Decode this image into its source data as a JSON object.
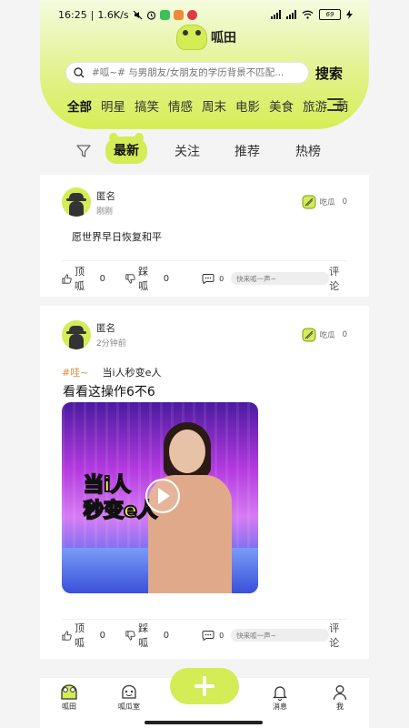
{
  "status_bar": {
    "time": "16:25",
    "speed": "1.6K/s",
    "battery": "69"
  },
  "app": {
    "logo_text": "呱田"
  },
  "search": {
    "placeholder": "#呱~# 与男朋友/女朋友的学历背景不匹配...",
    "button": "搜索"
  },
  "categories": [
    "全部",
    "明星",
    "搞笑",
    "情感",
    "周末",
    "电影",
    "美食",
    "旅游",
    "萌"
  ],
  "tabs": {
    "latest": "最新",
    "follow": "关注",
    "recommend": "推荐",
    "hot": "热榜"
  },
  "posts": [
    {
      "user": "匿名",
      "time": "刚刚",
      "eat_melon_label": "吃瓜",
      "eat_melon_count": "0",
      "text": "愿世界早日恢复和平",
      "likes_label": "顶呱",
      "likes": "0",
      "dislikes_label": "踩呱",
      "dislikes": "0",
      "comment_count": "0",
      "comment_placeholder": "快来呱一声~",
      "comment_label": "评论"
    },
    {
      "user": "匿名",
      "time": "2分钟前",
      "eat_melon_label": "吃瓜",
      "eat_melon_count": "0",
      "tag": "#哇~",
      "title": "当i人秒变e人",
      "body": "看看这操作6不6",
      "video_overlay_line1": "当i人",
      "video_overlay_line2": "秒变e人",
      "likes_label": "顶呱",
      "likes": "0",
      "dislikes_label": "踩呱",
      "dislikes": "0",
      "comment_count": "0",
      "comment_placeholder": "快来呱一声~",
      "comment_label": "评论"
    }
  ],
  "bottom_nav": {
    "home": "呱田",
    "melon_room": "呱瓜室",
    "messages": "消息",
    "me": "我"
  },
  "colors": {
    "accent": "#d4ec55",
    "tag": "#e28a3c"
  }
}
